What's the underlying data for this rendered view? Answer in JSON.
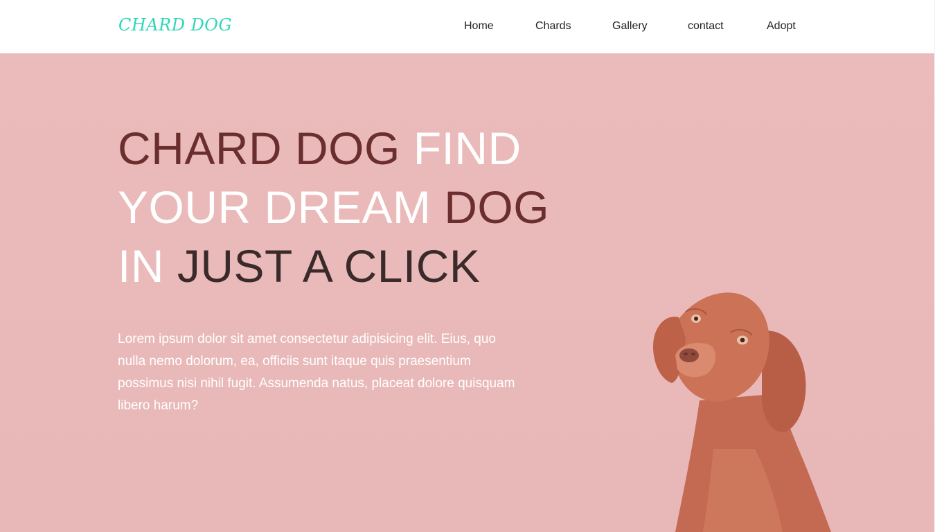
{
  "nav": {
    "brand": "CHARD DOG",
    "links": [
      "Home",
      "Chards",
      "Gallery",
      "contact",
      "Adopt"
    ]
  },
  "hero": {
    "headline": {
      "line1_a": "CHARD DOG",
      "line1_b": "FIND",
      "line2_a": "YOUR DREAM",
      "line2_b": "DOG",
      "line3_a": "IN",
      "line3_b": "JUST A CLICK"
    },
    "paragraph": "Lorem ipsum dolor sit amet consectetur adipisicing elit. Eius, quo nulla nemo dolorum, ea, officiis sunt itaque quis praesentium possimus nisi nihil fugit. Assumenda natus, placeat dolore quisquam libero harum?"
  },
  "colors": {
    "brand": "#2ed6b8",
    "hero_background": "#ebb9ba",
    "headline_dark": "#6b2e2f",
    "headline_white": "#ffffff",
    "headline_black": "#3a2a2a",
    "dog_fur": "#c8684f"
  }
}
